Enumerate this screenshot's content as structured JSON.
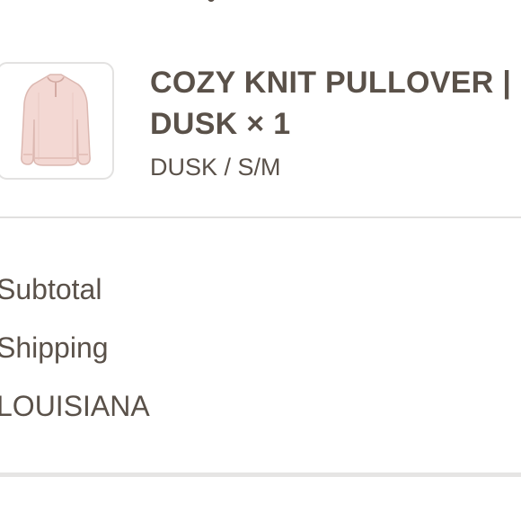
{
  "order": {
    "item": {
      "title": "COZY KNIT PULLOVER | DUSK",
      "quantity": "× 1",
      "variant": "DUSK / S/M",
      "thumbnail": "pink-knit-pullover-image"
    }
  },
  "summary": {
    "subtotal_label": "Subtotal",
    "shipping_label": "Shipping",
    "shipping_region": "LOUISIANA"
  },
  "colors": {
    "text": "#5a5149",
    "divider": "#e1e0df",
    "thumbnail_border": "#e3e2e1",
    "sweater": "#f2d6d1"
  }
}
